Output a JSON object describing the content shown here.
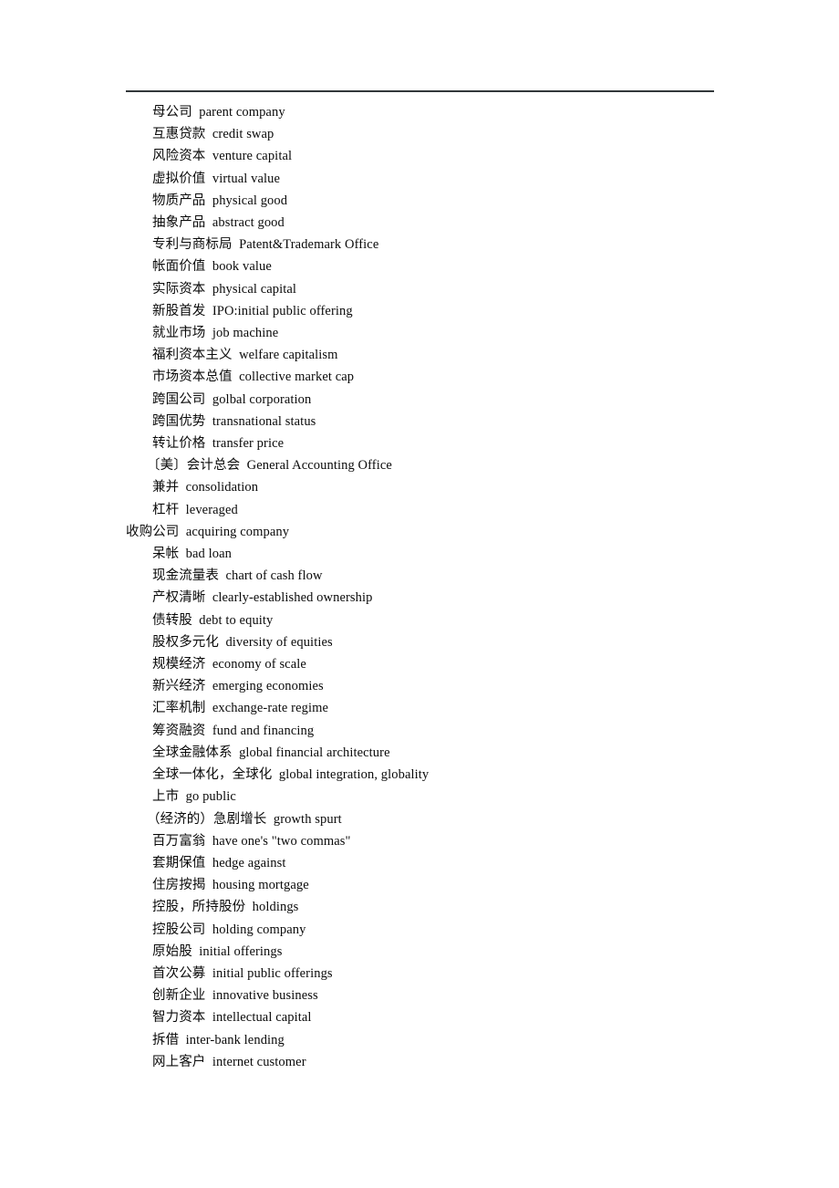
{
  "document": {
    "type": "bilingual-glossary",
    "language_pair": "Chinese-English",
    "has_top_rule": true,
    "text_color": "#0a0a0a",
    "rule_color": "#32383a",
    "background_color": "#ffffff",
    "separator": "  "
  },
  "entries": [
    {
      "term": "母公司",
      "gloss": "parent company",
      "indent": "normal"
    },
    {
      "term": "互惠贷款",
      "gloss": "credit swap",
      "indent": "normal"
    },
    {
      "term": "风险资本",
      "gloss": "venture capital",
      "indent": "normal"
    },
    {
      "term": "虚拟价值",
      "gloss": "virtual value",
      "indent": "normal"
    },
    {
      "term": "物质产品",
      "gloss": "physical good",
      "indent": "normal"
    },
    {
      "term": "抽象产品",
      "gloss": "abstract good",
      "indent": "normal"
    },
    {
      "term": "专利与商标局",
      "gloss": "Patent&Trademark Office",
      "indent": "normal"
    },
    {
      "term": "帐面价值",
      "gloss": "book value",
      "indent": "normal"
    },
    {
      "term": "实际资本",
      "gloss": "physical capital",
      "indent": "normal"
    },
    {
      "term": "新股首发",
      "gloss": "IPO:initial public offering",
      "indent": "normal"
    },
    {
      "term": "就业市场",
      "gloss": "job machine",
      "indent": "normal"
    },
    {
      "term": "福利资本主义",
      "gloss": "welfare capitalism",
      "indent": "normal"
    },
    {
      "term": "市场资本总值",
      "gloss": "collective market cap",
      "indent": "normal"
    },
    {
      "term": "跨国公司",
      "gloss": "golbal corporation",
      "indent": "normal"
    },
    {
      "term": "跨国优势",
      "gloss": "transnational status",
      "indent": "normal"
    },
    {
      "term": "转让价格",
      "gloss": "transfer price",
      "indent": "normal"
    },
    {
      "term": "〔美〕会计总会",
      "gloss": "General Accounting Office",
      "indent": "paren"
    },
    {
      "term": "兼并",
      "gloss": "consolidation",
      "indent": "normal"
    },
    {
      "term": "杠杆",
      "gloss": "leveraged",
      "indent": "normal"
    },
    {
      "term": "收购公司",
      "gloss": "acquiring company",
      "indent": "flush"
    },
    {
      "term": "呆帐",
      "gloss": "bad loan",
      "indent": "normal"
    },
    {
      "term": "现金流量表",
      "gloss": "chart of cash flow",
      "indent": "normal"
    },
    {
      "term": "产权清晰",
      "gloss": "clearly-established ownership",
      "indent": "normal"
    },
    {
      "term": "债转股",
      "gloss": "debt to equity",
      "indent": "normal"
    },
    {
      "term": "股权多元化",
      "gloss": "diversity of equities",
      "indent": "normal"
    },
    {
      "term": "规模经济",
      "gloss": "economy of scale",
      "indent": "normal"
    },
    {
      "term": "新兴经济",
      "gloss": "emerging economies",
      "indent": "normal"
    },
    {
      "term": "汇率机制",
      "gloss": "exchange-rate regime",
      "indent": "normal"
    },
    {
      "term": "筹资融资",
      "gloss": "fund and financing",
      "indent": "normal"
    },
    {
      "term": "全球金融体系",
      "gloss": "global financial architecture",
      "indent": "normal"
    },
    {
      "term": "全球一体化，全球化",
      "gloss": "global integration, globality",
      "indent": "normal"
    },
    {
      "term": "上市",
      "gloss": "go public",
      "indent": "normal"
    },
    {
      "term": "（经济的）急剧增长",
      "gloss": "growth spurt",
      "indent": "paren"
    },
    {
      "term": "百万富翁",
      "gloss": "have one's \"two commas\"",
      "indent": "normal"
    },
    {
      "term": "套期保值",
      "gloss": "hedge against",
      "indent": "normal"
    },
    {
      "term": "住房按揭",
      "gloss": "housing mortgage",
      "indent": "normal"
    },
    {
      "term": "控股，所持股份",
      "gloss": "holdings",
      "indent": "normal"
    },
    {
      "term": "控股公司",
      "gloss": "holding company",
      "indent": "normal"
    },
    {
      "term": "原始股",
      "gloss": "initial offerings",
      "indent": "normal"
    },
    {
      "term": "首次公募",
      "gloss": "initial public offerings",
      "indent": "normal"
    },
    {
      "term": "创新企业",
      "gloss": "innovative business",
      "indent": "normal"
    },
    {
      "term": "智力资本",
      "gloss": "intellectual capital",
      "indent": "normal"
    },
    {
      "term": "拆借",
      "gloss": "inter-bank lending",
      "indent": "normal"
    },
    {
      "term": "网上客户",
      "gloss": "internet customer",
      "indent": "normal"
    }
  ]
}
